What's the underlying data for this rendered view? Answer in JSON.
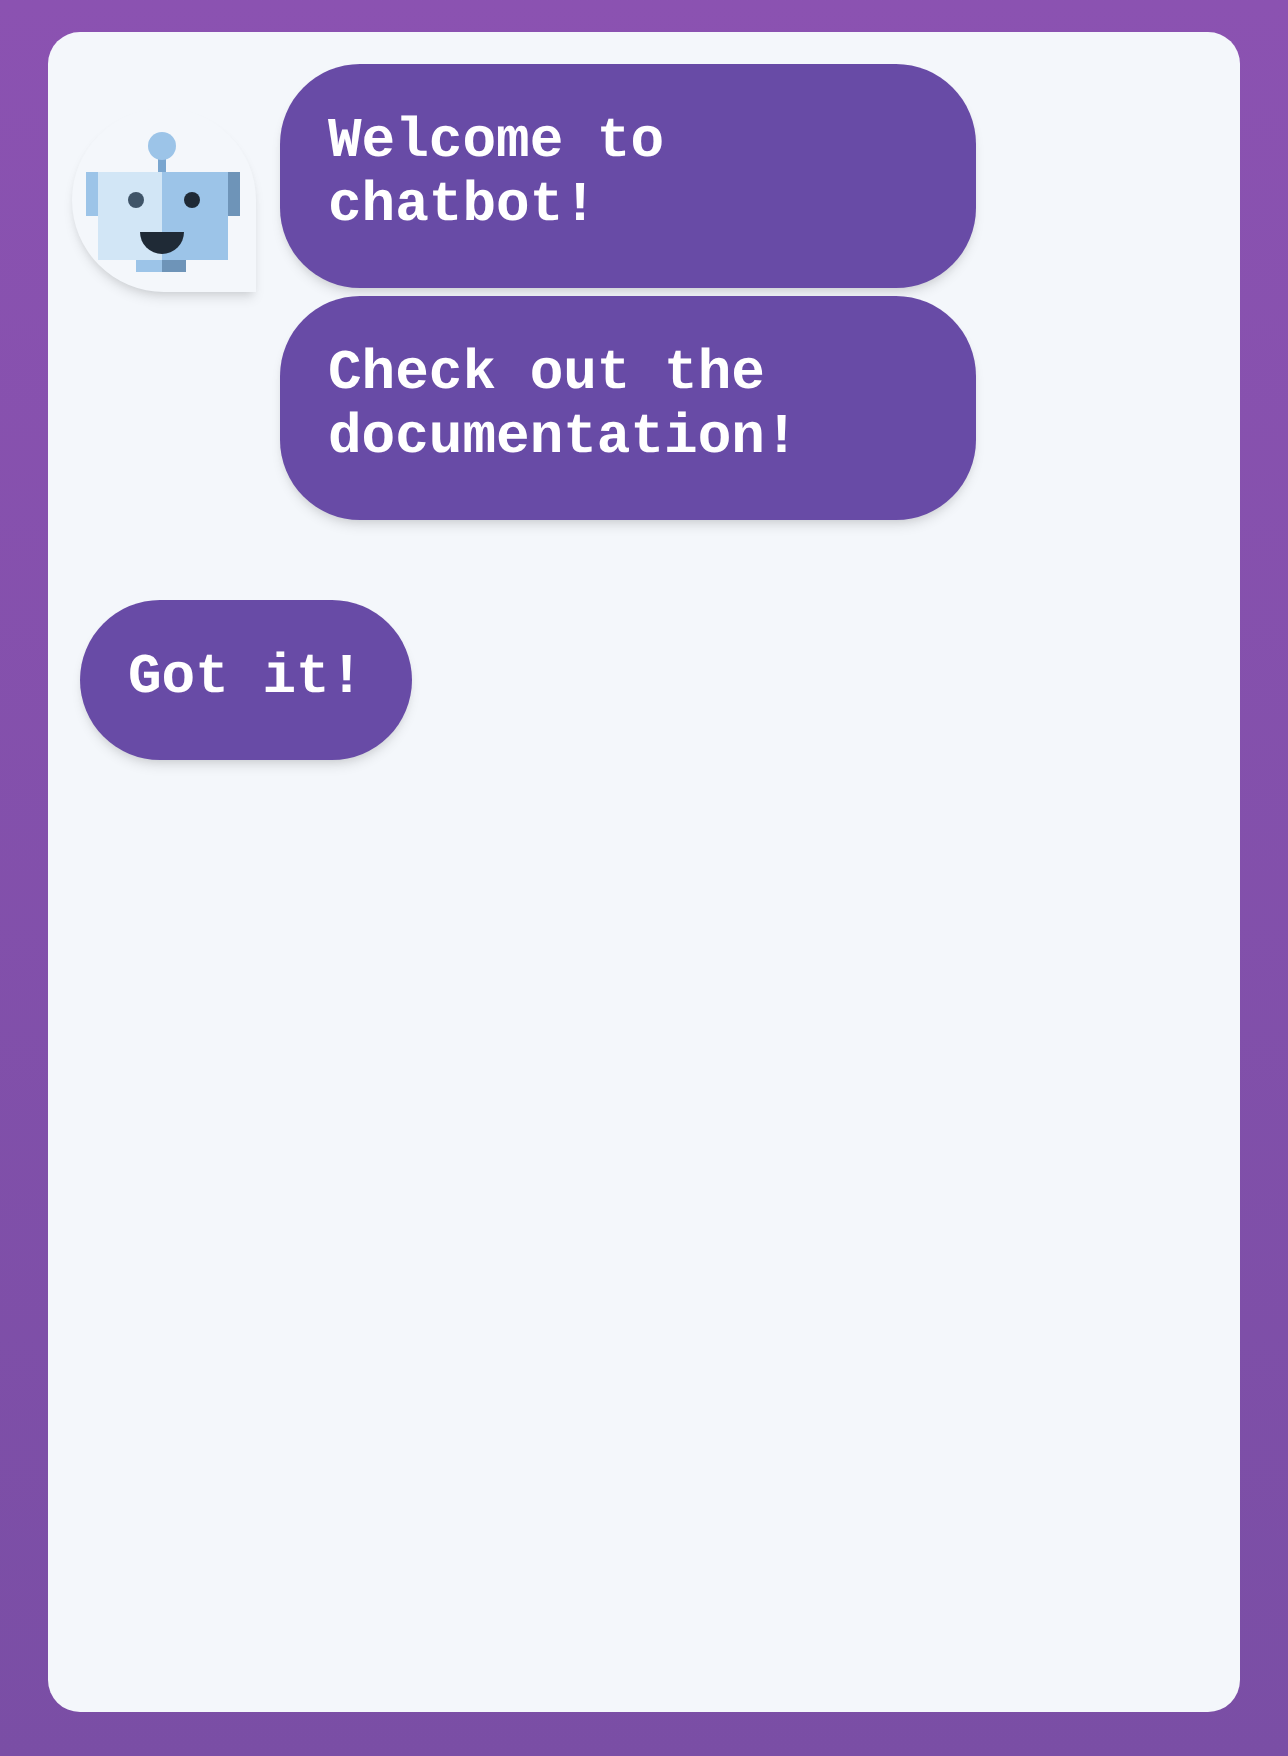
{
  "conversation": [
    {
      "kind": "bot",
      "messages": [
        "Welcome to chatbot!",
        "Check out the documentation!"
      ]
    },
    {
      "kind": "user",
      "messages": [
        "Got it!"
      ]
    }
  ]
}
